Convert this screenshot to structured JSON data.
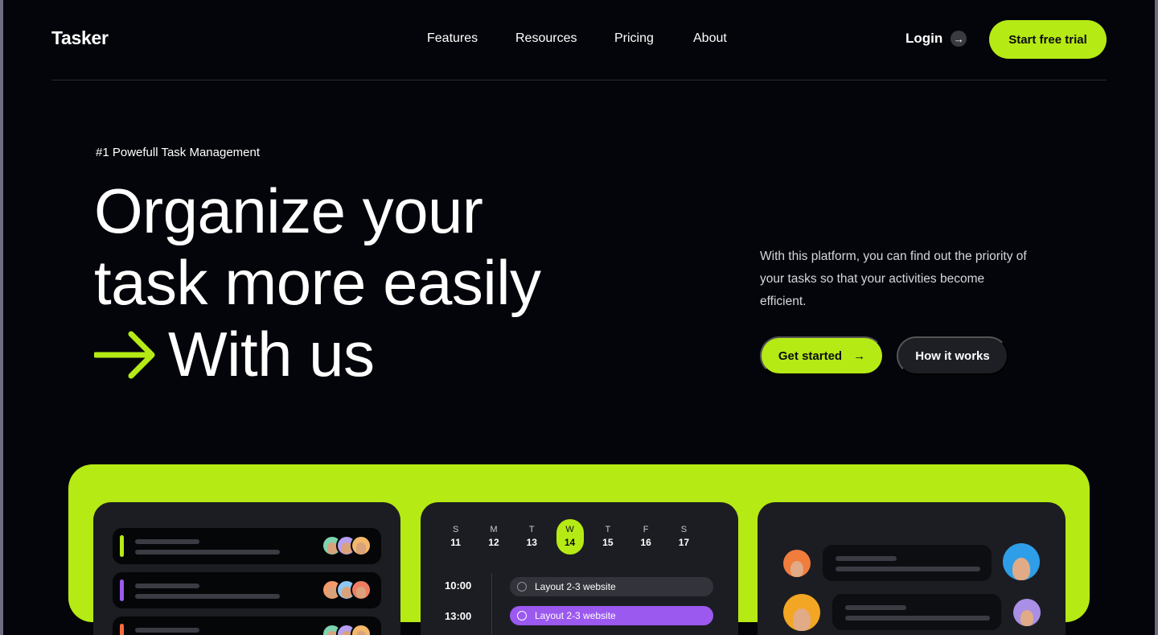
{
  "brand": {
    "name": "Tasker",
    "accent": "#b5ea15",
    "background": "#04050a"
  },
  "nav": {
    "items": [
      "Features",
      "Resources",
      "Pricing",
      "About"
    ],
    "login_label": "Login",
    "login_icon": "arrow-right-icon",
    "cta_label": "Start free trial"
  },
  "hero": {
    "eyebrow": "#1 Powefull Task Management",
    "line1": "Organize your",
    "line2": "task more easily",
    "line3": "With us",
    "line3_icon": "arrow-right-icon",
    "description": "With this platform, you can find out the priority of your tasks so that your activities become efficient.",
    "primary_label": "Get started",
    "secondary_label": "How it works"
  },
  "showcase": {
    "tasks": [
      {
        "color": "#b5ea15"
      },
      {
        "color": "#9b59f0"
      },
      {
        "color": "#ff6b3d"
      }
    ],
    "calendar": {
      "days": [
        {
          "wd": "S",
          "num": "11"
        },
        {
          "wd": "M",
          "num": "12"
        },
        {
          "wd": "T",
          "num": "13"
        },
        {
          "wd": "W",
          "num": "14"
        },
        {
          "wd": "T",
          "num": "15"
        },
        {
          "wd": "F",
          "num": "16"
        },
        {
          "wd": "S",
          "num": "17"
        }
      ],
      "active_index": 3,
      "times": [
        "10:00",
        "13:00"
      ],
      "events": [
        "Layout 2-3 website",
        "Layout 2-3 website"
      ]
    }
  }
}
